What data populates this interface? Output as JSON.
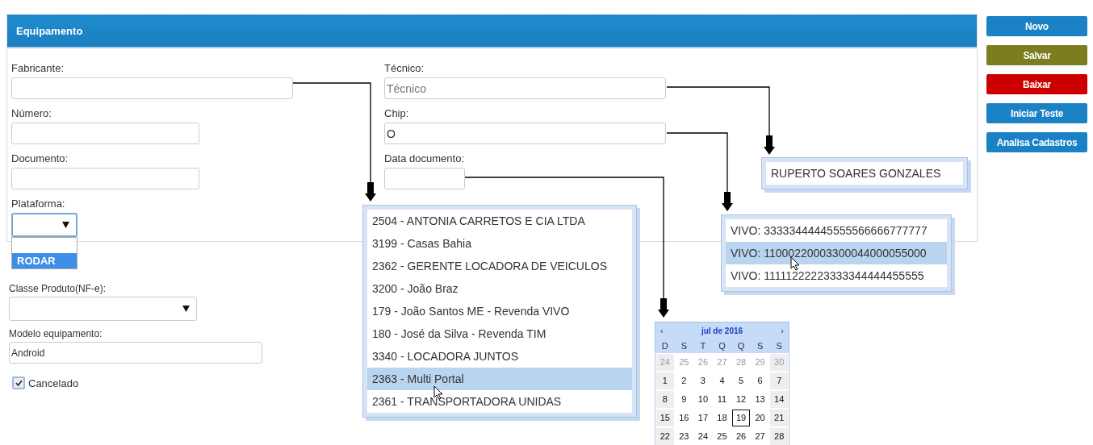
{
  "panel": {
    "title": "Equipamento",
    "left_fields": [
      {
        "label": "Fabricante:",
        "kind": "text"
      },
      {
        "label": "Número:",
        "kind": "text"
      },
      {
        "label": "Documento:",
        "kind": "text"
      },
      {
        "label": "Plataforma:",
        "kind": "select",
        "options": [
          {
            "label": "RODAR",
            "selected": true
          }
        ]
      }
    ],
    "right_fields": [
      {
        "label": "Técnico:",
        "kind": "text",
        "placeholder": "Técnico"
      },
      {
        "label": "Chip:",
        "kind": "text",
        "value": "O"
      },
      {
        "label": "Data documento:",
        "kind": "text"
      }
    ]
  },
  "lower_fields": [
    {
      "label": "Classe Produto(NF-e):",
      "kind": "select"
    },
    {
      "label": "Modelo equipamento:",
      "kind": "text",
      "value": "Android"
    },
    {
      "label": "Cancelado",
      "kind": "checkbox",
      "checked": true
    }
  ],
  "buttons": [
    {
      "label": "Novo",
      "color": "#1a82c4"
    },
    {
      "label": "Salvar",
      "color": "#7b7d1e"
    },
    {
      "label": "Baixar",
      "color": "#cc0000"
    },
    {
      "label": "Iniciar Teste",
      "color": "#1a82c4"
    },
    {
      "label": "Analisa Cadastros",
      "color": "#1a82c4"
    }
  ],
  "fabricante_suggestions": [
    {
      "label": "2504 - ANTONIA CARRETOS E CIA LTDA",
      "selected": false
    },
    {
      "label": "3199 - Casas Bahia",
      "selected": false
    },
    {
      "label": "2362 - GERENTE LOCADORA DE VEICULOS",
      "selected": false
    },
    {
      "label": "3200 - João Braz",
      "selected": false
    },
    {
      "label": "179 - João Santos ME - Revenda VIVO",
      "selected": false
    },
    {
      "label": "180 - José da Silva - Revenda TIM",
      "selected": false
    },
    {
      "label": "3340 - LOCADORA JUNTOS",
      "selected": false
    },
    {
      "label": "2363 - Multi Portal",
      "selected": true
    },
    {
      "label": "2361 - TRANSPORTADORA UNIDAS",
      "selected": false
    }
  ],
  "tecnico_suggestions": [
    {
      "label": "RUPERTO SOARES GONZALES",
      "selected": false
    }
  ],
  "chip_suggestions": [
    {
      "label": "VIVO: 33333444445555566666777777",
      "selected": false
    },
    {
      "label": "VIVO: 11000220003300044000055000",
      "selected": true
    },
    {
      "label": "VIVO: 11111222223333344444455555",
      "selected": false
    }
  ],
  "calendar": {
    "prev": "‹",
    "title": "jul de 2016",
    "next": "›",
    "weekdays": [
      "D",
      "S",
      "T",
      "Q",
      "Q",
      "S",
      "S"
    ],
    "weeks": [
      [
        {
          "day": "24",
          "other_month": true,
          "selected": false
        },
        {
          "day": "25",
          "other_month": true,
          "selected": false
        },
        {
          "day": "26",
          "other_month": true,
          "selected": false
        },
        {
          "day": "27",
          "other_month": true,
          "selected": false
        },
        {
          "day": "28",
          "other_month": true,
          "selected": false
        },
        {
          "day": "29",
          "other_month": true,
          "selected": false
        },
        {
          "day": "30",
          "other_month": true,
          "selected": false
        }
      ],
      [
        {
          "day": "1",
          "other_month": false,
          "selected": false
        },
        {
          "day": "2",
          "other_month": false,
          "selected": false
        },
        {
          "day": "3",
          "other_month": false,
          "selected": false
        },
        {
          "day": "4",
          "other_month": false,
          "selected": false
        },
        {
          "day": "5",
          "other_month": false,
          "selected": false
        },
        {
          "day": "6",
          "other_month": false,
          "selected": false
        },
        {
          "day": "7",
          "other_month": false,
          "selected": false
        }
      ],
      [
        {
          "day": "8",
          "other_month": false,
          "selected": false
        },
        {
          "day": "9",
          "other_month": false,
          "selected": false
        },
        {
          "day": "10",
          "other_month": false,
          "selected": false
        },
        {
          "day": "11",
          "other_month": false,
          "selected": false
        },
        {
          "day": "12",
          "other_month": false,
          "selected": false
        },
        {
          "day": "13",
          "other_month": false,
          "selected": false
        },
        {
          "day": "14",
          "other_month": false,
          "selected": false
        }
      ],
      [
        {
          "day": "15",
          "other_month": false,
          "selected": false
        },
        {
          "day": "16",
          "other_month": false,
          "selected": false
        },
        {
          "day": "17",
          "other_month": false,
          "selected": false
        },
        {
          "day": "18",
          "other_month": false,
          "selected": false
        },
        {
          "day": "19",
          "other_month": false,
          "selected": true
        },
        {
          "day": "20",
          "other_month": false,
          "selected": false
        },
        {
          "day": "21",
          "other_month": false,
          "selected": false
        }
      ],
      [
        {
          "day": "22",
          "other_month": false,
          "selected": false
        },
        {
          "day": "23",
          "other_month": false,
          "selected": false
        },
        {
          "day": "24",
          "other_month": false,
          "selected": false
        },
        {
          "day": "25",
          "other_month": false,
          "selected": false
        },
        {
          "day": "26",
          "other_month": false,
          "selected": false
        },
        {
          "day": "27",
          "other_month": false,
          "selected": false
        },
        {
          "day": "28",
          "other_month": false,
          "selected": false
        }
      ]
    ]
  }
}
